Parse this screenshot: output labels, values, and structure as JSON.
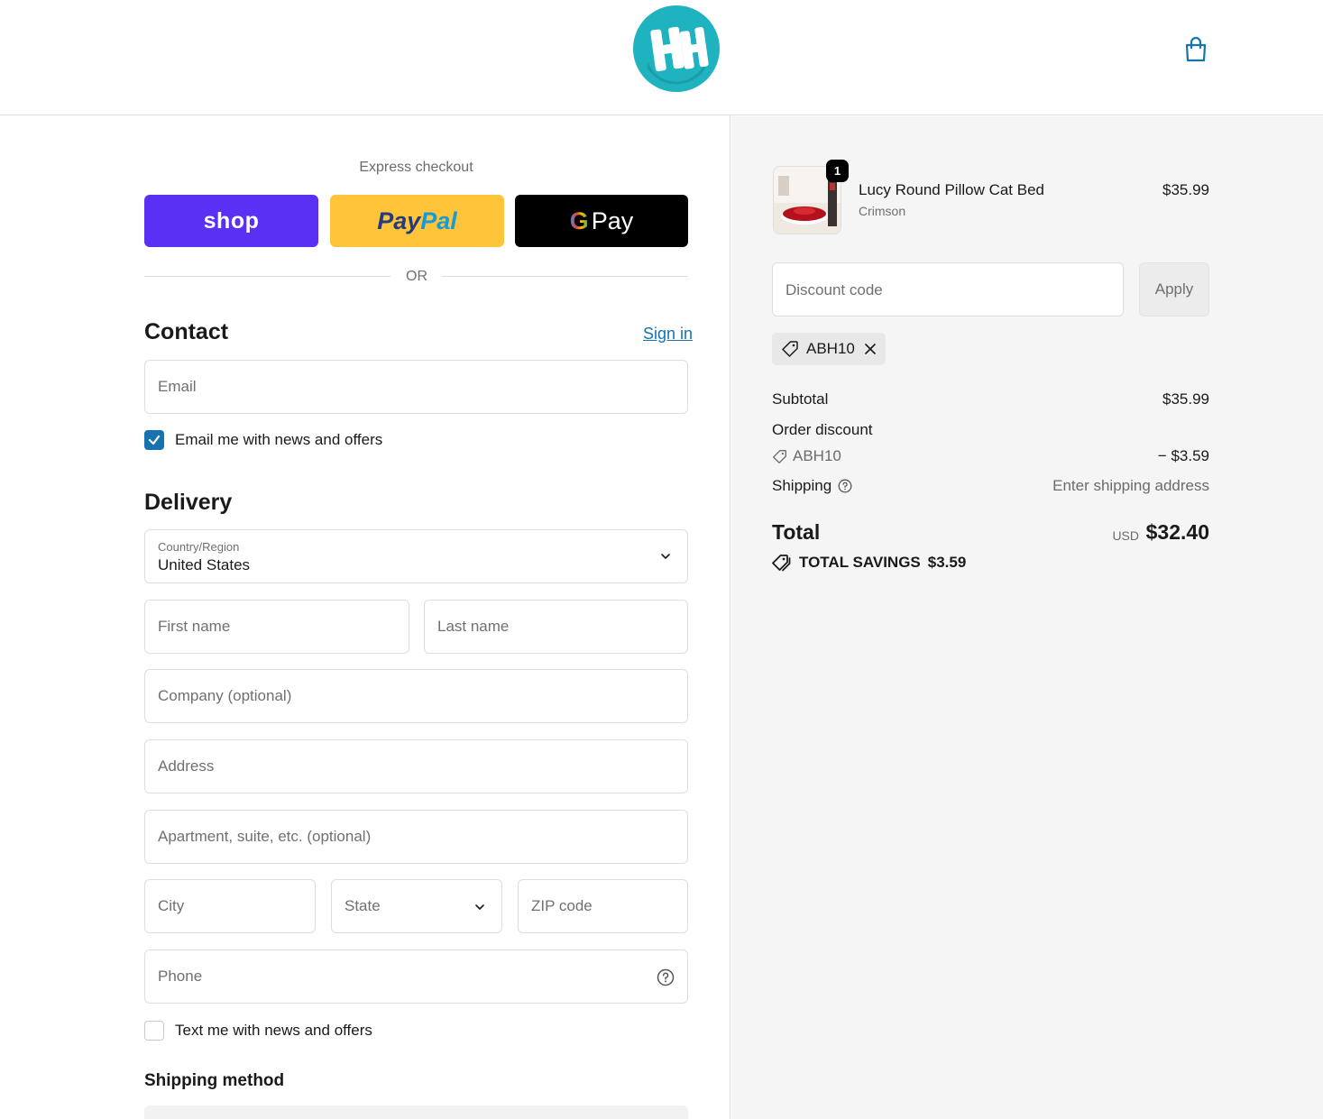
{
  "header": {
    "logo_name": "HH",
    "brand_color": "#1fb3bf",
    "cart_icon": "shopping-bag-icon"
  },
  "express": {
    "title": "Express checkout",
    "shop_label": "shop",
    "paypal_part1": "Pay",
    "paypal_part2": "Pal",
    "gpay_g": "G",
    "gpay_label": "Pay",
    "or_label": "OR"
  },
  "contact": {
    "title": "Contact",
    "signin_label": "Sign in",
    "email_placeholder": "Email",
    "email_news_label": "Email me with news and offers",
    "email_news_checked": true
  },
  "delivery": {
    "title": "Delivery",
    "country_label": "Country/Region",
    "country_value": "United States",
    "first_name_placeholder": "First name",
    "last_name_placeholder": "Last name",
    "company_placeholder": "Company (optional)",
    "address_placeholder": "Address",
    "apartment_placeholder": "Apartment, suite, etc. (optional)",
    "city_placeholder": "City",
    "state_placeholder": "State",
    "zip_placeholder": "ZIP code",
    "phone_placeholder": "Phone",
    "text_news_label": "Text me with news and offers",
    "text_news_checked": false
  },
  "shipping": {
    "title": "Shipping method"
  },
  "order": {
    "quantity": "1",
    "product_name": "Lucy Round Pillow Cat Bed",
    "product_variant": "Crimson",
    "product_price": "$35.99",
    "discount_placeholder": "Discount code",
    "apply_label": "Apply",
    "applied_code": "ABH10",
    "subtotal_label": "Subtotal",
    "subtotal_value": "$35.99",
    "order_discount_label": "Order discount",
    "discount_code": "ABH10",
    "discount_value": "− $3.59",
    "shipping_label": "Shipping",
    "shipping_value": "Enter shipping address",
    "total_label": "Total",
    "total_currency": "USD",
    "total_value": "$32.40",
    "savings_label": "TOTAL SAVINGS",
    "savings_value": "$3.59"
  },
  "colors": {
    "accent": "#1773b0",
    "shop_purple": "#5a31f4",
    "paypal_yellow": "#ffc439"
  }
}
